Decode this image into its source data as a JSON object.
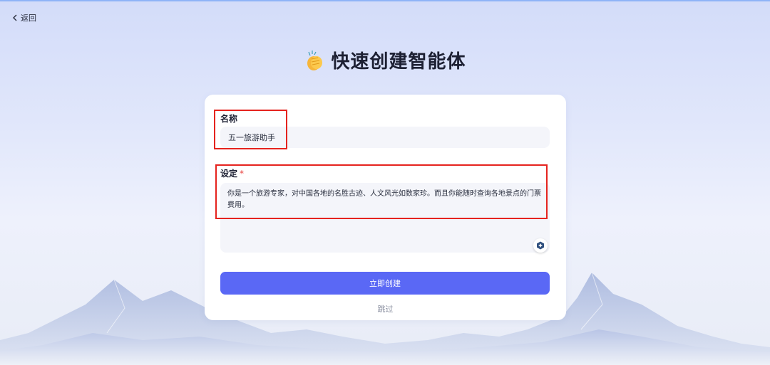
{
  "nav": {
    "back_label": "返回"
  },
  "page": {
    "title": "快速创建智能体"
  },
  "form": {
    "name_label": "名称",
    "name_value": "五一旅游助手",
    "setting_label": "设定",
    "setting_required_mark": "*",
    "setting_value": "你是一个旅游专家，对中国各地的名胜古迹、人文风光如数家珍。而且你能随时查询各地景点的门票费用。"
  },
  "actions": {
    "create_label": "立即创建",
    "skip_label": "跳过"
  },
  "colors": {
    "primary": "#5a68f5",
    "highlight": "#e5231e",
    "background": "#dfe6fb"
  }
}
